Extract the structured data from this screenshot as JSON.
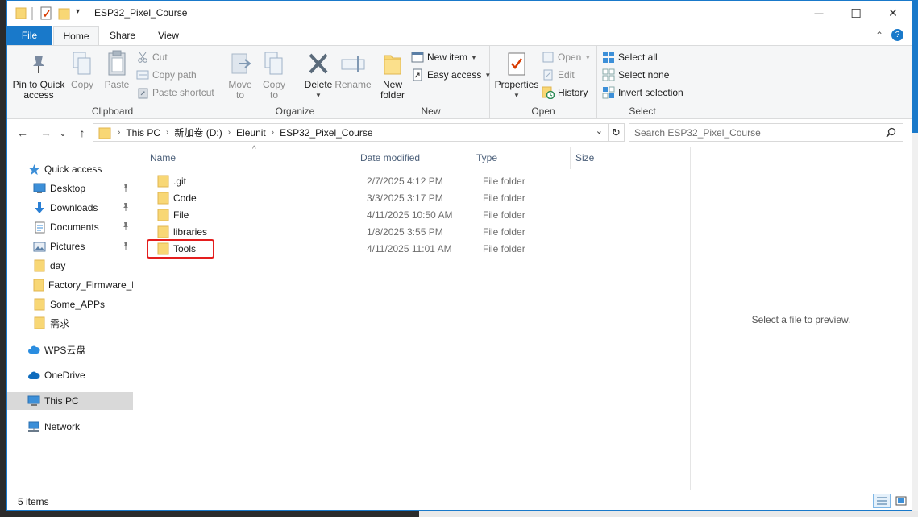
{
  "window": {
    "title": "ESP32_Pixel_Course",
    "qat_dropdown_glyph": "▾",
    "minimize_glyph": "—",
    "maximize_glyph": "☐",
    "close_glyph": "✕"
  },
  "ribbon_tabs": {
    "file": "File",
    "home": "Home",
    "share": "Share",
    "view": "View",
    "collapse_glyph": "⌃",
    "help_glyph": "?"
  },
  "ribbon": {
    "clipboard": {
      "label": "Clipboard",
      "pin_line1": "Pin to Quick",
      "pin_line2": "access",
      "copy": "Copy",
      "paste": "Paste",
      "cut": "Cut",
      "copy_path": "Copy path",
      "paste_shortcut": "Paste shortcut"
    },
    "organize": {
      "label": "Organize",
      "move_line1": "Move",
      "move_line2": "to",
      "copy_line1": "Copy",
      "copy_line2": "to",
      "delete": "Delete",
      "rename": "Rename"
    },
    "new": {
      "label": "New",
      "new_folder_line1": "New",
      "new_folder_line2": "folder",
      "new_item": "New item",
      "easy_access": "Easy access"
    },
    "open": {
      "label": "Open",
      "properties": "Properties",
      "open": "Open",
      "edit": "Edit",
      "history": "History"
    },
    "select": {
      "label": "Select",
      "select_all": "Select all",
      "select_none": "Select none",
      "invert_selection": "Invert selection"
    }
  },
  "address": {
    "back_glyph": "←",
    "forward_glyph": "→",
    "recent_glyph": "⌄",
    "up_glyph": "↑",
    "separator": "›",
    "crumbs": [
      "This PC",
      "新加卷 (D:)",
      "Eleunit",
      "ESP32_Pixel_Course"
    ],
    "dropdown_glyph": "⌄",
    "refresh_glyph": "↻",
    "search_placeholder": "Search ESP32_Pixel_Course"
  },
  "nav_pane": {
    "quick_access": "Quick access",
    "desktop": "Desktop",
    "downloads": "Downloads",
    "documents": "Documents",
    "pictures": "Pictures",
    "day": "day",
    "factory_firmware": "Factory_Firmware_b",
    "some_apps": "Some_APPs",
    "xuqiu": "需求",
    "wps_cloud": "WPS云盘",
    "onedrive": "OneDrive",
    "this_pc": "This PC",
    "network": "Network"
  },
  "file_list": {
    "sort_glyph": "^",
    "columns": {
      "name": "Name",
      "date_modified": "Date modified",
      "type": "Type",
      "size": "Size"
    },
    "rows": [
      {
        "name": ".git",
        "date": "2/7/2025 4:12 PM",
        "type": "File folder",
        "size": ""
      },
      {
        "name": "Code",
        "date": "3/3/2025 3:17 PM",
        "type": "File folder",
        "size": ""
      },
      {
        "name": "File",
        "date": "4/11/2025 10:50 AM",
        "type": "File folder",
        "size": ""
      },
      {
        "name": "libraries",
        "date": "1/8/2025 3:55 PM",
        "type": "File folder",
        "size": ""
      },
      {
        "name": "Tools",
        "date": "4/11/2025 11:01 AM",
        "type": "File folder",
        "size": ""
      }
    ],
    "highlighted_item": "Tools"
  },
  "preview": {
    "text": "Select a file to preview."
  },
  "status": {
    "item_count": "5 items"
  },
  "colors": {
    "accent": "#1979ca",
    "folder": "#f8d775",
    "folder_dark": "#e0b650",
    "highlight": "#e41e1e",
    "selected_nav": "#d9d9d9"
  }
}
